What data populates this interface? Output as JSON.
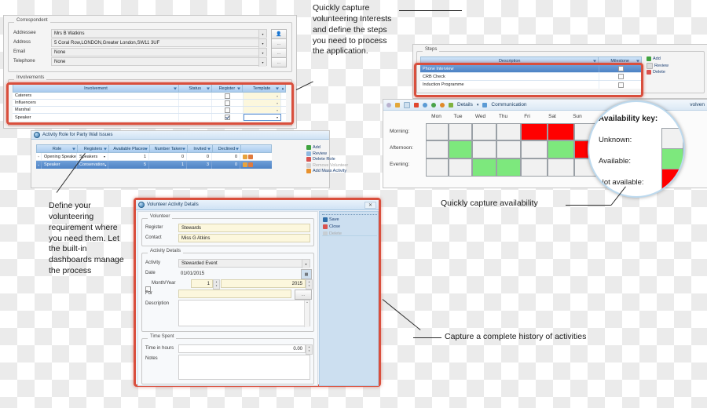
{
  "correspondent_form": {
    "group_caption": "Correspondent",
    "fields": [
      {
        "label": "Addressee",
        "value": "Mrs B Watkins",
        "control": "dropdown-with-contact-button"
      },
      {
        "label": "Address",
        "value": "5 Coral Row,LONDON,Greater London,SW11 3UF",
        "control": "dropdown-with-ellipsis"
      },
      {
        "label": "Email",
        "value": "None",
        "control": "dropdown-with-ellipsis"
      },
      {
        "label": "Telephone",
        "value": "None",
        "control": "dropdown-with-ellipsis"
      }
    ],
    "involvements": {
      "group_caption": "Involvements",
      "columns": [
        "Involvement",
        "Status",
        "Register",
        "Template"
      ],
      "rows": [
        {
          "involvement": "Caterers",
          "status": "",
          "register_checked": false,
          "template": ""
        },
        {
          "involvement": "Influencers",
          "status": "",
          "register_checked": false,
          "template": ""
        },
        {
          "involvement": "Marshal",
          "status": "",
          "register_checked": false,
          "template": ""
        },
        {
          "involvement": "Speaker",
          "status": "",
          "register_checked": true,
          "template": ""
        }
      ]
    }
  },
  "steps_panel": {
    "group_caption": "Steps",
    "columns": [
      "Description",
      "Milestone"
    ],
    "rows": [
      {
        "description": "Phone Interview",
        "milestone_checked": false,
        "selected": true
      },
      {
        "description": "CRB Check",
        "milestone_checked": false,
        "selected": false
      },
      {
        "description": "Induction Programme",
        "milestone_checked": false,
        "selected": false
      }
    ],
    "buttons": [
      {
        "label": "Add",
        "enabled": true,
        "color": "#3fa33f"
      },
      {
        "label": "Review",
        "enabled": true,
        "color": "#d8d8d8"
      },
      {
        "label": "Delete",
        "enabled": true,
        "color": "#d9534f"
      }
    ]
  },
  "activity_role_window": {
    "title": "Activity Role for Party Wall Issues",
    "columns": [
      "Role",
      "Registers",
      "Available Places",
      "Number Taken",
      "Invited",
      "Declined"
    ],
    "rows": [
      {
        "role": "Opening Speaker",
        "registers": "Speakers",
        "available_places": "1",
        "number_taken": "0",
        "invited": "0",
        "declined": "0",
        "selected": false
      },
      {
        "role": "Speaker",
        "registers": "Conservation",
        "available_places": "5",
        "number_taken": "1",
        "invited": "3",
        "declined": "0",
        "selected": true
      }
    ],
    "buttons": [
      {
        "label": "Add",
        "enabled": true,
        "color": "#3fa33f"
      },
      {
        "label": "Review",
        "enabled": true,
        "color": "#8fb9e0"
      },
      {
        "label": "Delete Role",
        "enabled": true,
        "color": "#d9534f"
      },
      {
        "label": "Remove Volunteer",
        "enabled": false,
        "color": "#c9c9c9"
      },
      {
        "label": "Add Mass Activity",
        "enabled": true,
        "color": "#e8912d"
      }
    ]
  },
  "volunteer_dialog": {
    "title": "Volunteer Activity Details",
    "close_label": "✕",
    "sections": {
      "volunteer": {
        "caption": "Volunteer",
        "register_label": "Register",
        "register_value": "Stewards",
        "contact_label": "Contact",
        "contact_value": "Miss G Atkins"
      },
      "activity_details": {
        "caption": "Activity Details",
        "activity_label": "Activity",
        "activity_value": "Stewarded Event",
        "date_label": "Date",
        "date_value": "01/01/2015",
        "month_year_label": "Month/Year",
        "month_year_checked": false,
        "month_value": "1",
        "year_value": "2015",
        "for_label": "For",
        "for_value": "",
        "description_label": "Description",
        "description_value": ""
      },
      "time_spent": {
        "caption": "Time Spent",
        "time_label": "Time in hours",
        "time_value": "0.00",
        "notes_label": "Notes",
        "notes_value": ""
      }
    },
    "buttons": [
      {
        "label": "Save",
        "enabled": true
      },
      {
        "label": "Close",
        "enabled": true
      },
      {
        "label": "Delete",
        "enabled": false
      }
    ]
  },
  "availability_window": {
    "toolbar": {
      "icons": [
        "gear-icon",
        "lock-icon",
        "copy-icon",
        "book-icon",
        "globe-add-icon",
        "globe-flag-icon",
        "globe-icon"
      ],
      "details_label": "Details",
      "details_caret": "▾",
      "communications_label": "Communication",
      "involvements_label": "volven"
    },
    "days": [
      "Mon",
      "Tue",
      "Wed",
      "Thu",
      "Fri",
      "Sat",
      "Sun"
    ],
    "periods": [
      "Morning:",
      "Afternoon:",
      "Evening:"
    ],
    "grid": [
      [
        "unknown",
        "unknown",
        "unknown",
        "unknown",
        "notavailable",
        "notavailable",
        "unknown"
      ],
      [
        "unknown",
        "available",
        "unknown",
        "unknown",
        "unknown",
        "available",
        "notavailable"
      ],
      [
        "unknown",
        "unknown",
        "available",
        "available",
        "unknown",
        "unknown",
        "unknown"
      ]
    ],
    "key": {
      "title": "Availability key:",
      "items": [
        {
          "label": "Unknown:",
          "color": "#f1f1f1"
        },
        {
          "label": "Available:",
          "color": "#7de87d"
        },
        {
          "label": "Not available:",
          "color": "#ff0000"
        }
      ]
    }
  },
  "annotations": [
    {
      "id": "note-steps",
      "text": "Quickly capture volunteering Interests and define the steps you need to process the application."
    },
    {
      "id": "note-requirement",
      "text": "Define your volunteering requirement where you need them. Let the built-in dashboards manage the process"
    },
    {
      "id": "note-availability",
      "text": "Quickly capture availability"
    },
    {
      "id": "note-history",
      "text": "Capture  a complete history of activities"
    }
  ],
  "colors": {
    "highlight_box": "#d94f3d",
    "available": "#7de87d",
    "not_available": "#ff0000",
    "unknown": "#f1f1f1",
    "selection": "#4d82c4"
  }
}
